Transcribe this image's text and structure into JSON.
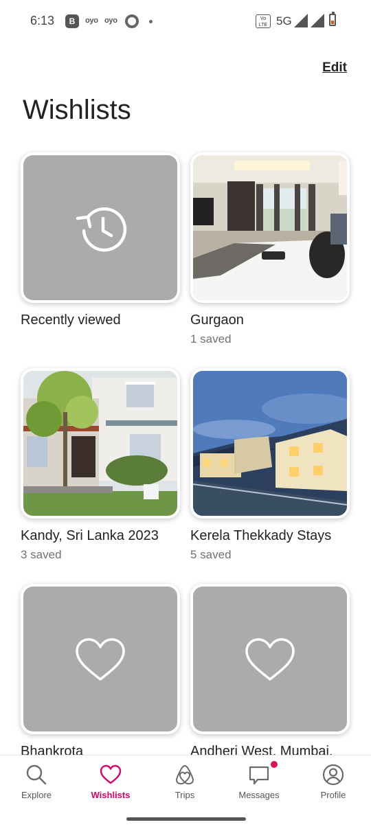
{
  "status_bar": {
    "time": "6:13",
    "b_badge": "B",
    "oyo1": "oyo",
    "oyo2": "oyo",
    "volte": "Vo LTE",
    "network": "5G"
  },
  "header": {
    "edit_label": "Edit",
    "title": "Wishlists"
  },
  "wishlists": [
    {
      "title": "Recently viewed",
      "count": "",
      "thumb": "history-icon"
    },
    {
      "title": "Gurgaon",
      "count": "1 saved",
      "thumb": "bedroom-photo"
    },
    {
      "title": "Kandy, Sri Lanka 2023",
      "count": "3 saved",
      "thumb": "house-photo"
    },
    {
      "title": "Kerela Thekkady Stays",
      "count": "5 saved",
      "thumb": "resort-photo"
    },
    {
      "title": "Bhankrota",
      "count": "",
      "thumb": "heart-icon"
    },
    {
      "title": "Andheri West, Mumbai,",
      "count": "",
      "thumb": "heart-icon"
    }
  ],
  "nav": {
    "items": [
      {
        "label": "Explore",
        "icon": "search-icon"
      },
      {
        "label": "Wishlists",
        "icon": "heart-icon",
        "active": true
      },
      {
        "label": "Trips",
        "icon": "airbnb-logo-icon"
      },
      {
        "label": "Messages",
        "icon": "message-icon",
        "badge": true
      },
      {
        "label": "Profile",
        "icon": "profile-icon"
      }
    ]
  },
  "colors": {
    "accent": "#d70466",
    "placeholder": "#ababab",
    "text": "#222222",
    "secondary": "#717171"
  }
}
